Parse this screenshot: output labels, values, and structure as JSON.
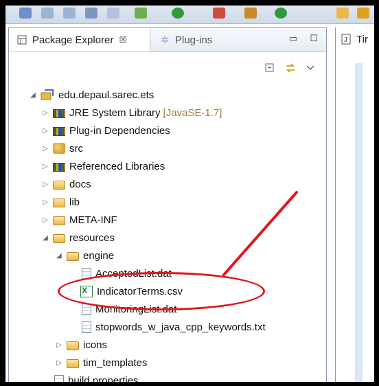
{
  "tabs": {
    "package_explorer": "Package Explorer",
    "package_explorer_close": "☒",
    "plugins": "Plug-ins",
    "editor_tab": "Tir"
  },
  "tree": {
    "project": "edu.depaul.sarec.ets",
    "items": [
      {
        "label": "JRE System Library",
        "decoration": "[JavaSE-1.7]",
        "icon": "library-icon"
      },
      {
        "label": "Plug-in Dependencies",
        "icon": "library-icon"
      },
      {
        "label": "src",
        "icon": "package-icon"
      },
      {
        "label": "Referenced Libraries",
        "icon": "library-icon"
      },
      {
        "label": "docs",
        "icon": "folder-icon"
      },
      {
        "label": "lib",
        "icon": "folder-icon"
      },
      {
        "label": "META-INF",
        "icon": "folder-icon"
      },
      {
        "label": "resources",
        "icon": "folder-open-icon"
      },
      {
        "label": "engine",
        "icon": "folder-open-icon"
      },
      {
        "label": "AcceptedList.dat",
        "icon": "file-icon"
      },
      {
        "label": "IndicatorTerms.csv",
        "icon": "csv-file-icon"
      },
      {
        "label": "MonitoringList.dat",
        "icon": "file-icon"
      },
      {
        "label": "stopwords_w_java_cpp_keywords.txt",
        "icon": "file-icon"
      },
      {
        "label": "icons",
        "icon": "folder-icon"
      },
      {
        "label": "tim_templates",
        "icon": "folder-icon"
      },
      {
        "label": "build.properties",
        "icon": "file-icon"
      }
    ]
  },
  "annotation": {
    "color": "#e0161b"
  }
}
